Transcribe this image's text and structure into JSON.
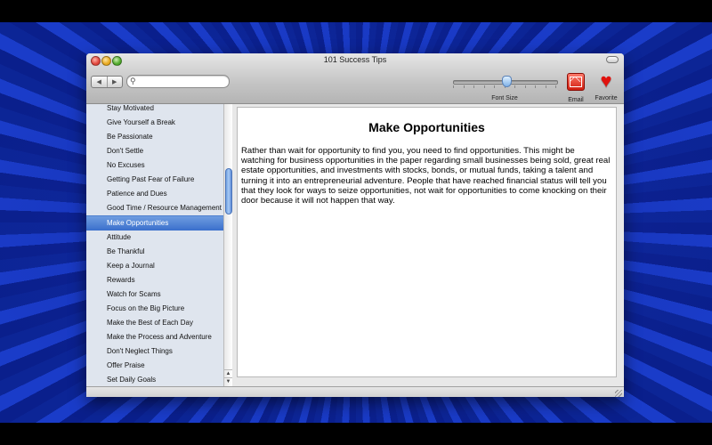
{
  "window": {
    "title": "101 Success Tips"
  },
  "toolbar": {
    "search_value": "",
    "font_size_label": "Font Size",
    "font_size_level": 0.52,
    "email_label": "Email",
    "favorite_label": "Favorite",
    "back_glyph": "◀",
    "forward_glyph": "▶",
    "search_glyph": "⚲"
  },
  "sidebar": {
    "items": [
      "Stay Motivated",
      "Give Yourself a Break",
      "Be Passionate",
      "Don't Settle",
      "No Excuses",
      "Getting Past Fear of Failure",
      "Patience and Dues",
      "Good Time / Resource Management",
      "Make Opportunities",
      "Attitude",
      "Be Thankful",
      "Keep a Journal",
      "Rewards",
      "Watch for Scams",
      "Focus on the Big Picture",
      "Make the Best of Each Day",
      "Make the Process and Adventure",
      "Don't Neglect Things",
      "Offer Praise",
      "Set Daily Goals"
    ],
    "selected_index": 8
  },
  "content": {
    "title": "Make Opportunities",
    "body": "Rather than wait for opportunity to find you, you need to find opportunities. This might be watching for business opportunities in the paper regarding small businesses being sold, great real estate opportunities, and investments with stocks, bonds, or mutual funds, taking a talent and turning it into an entrepreneurial adventure. People that have reached financial status will tell you that they look for ways to seize opportunities, not wait for opportunities to come knocking on their door because it will not happen that way."
  }
}
